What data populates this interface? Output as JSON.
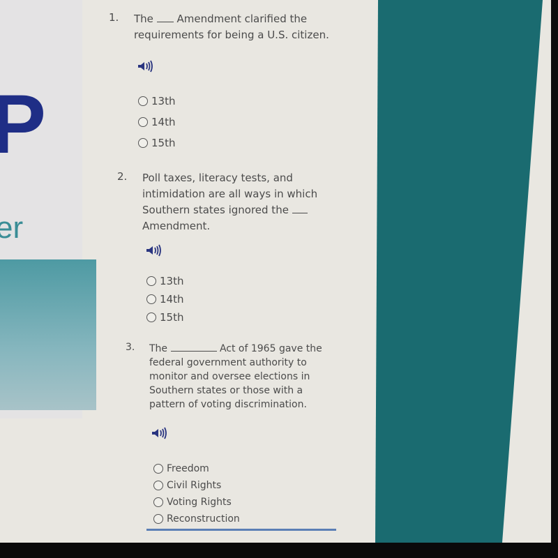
{
  "banner": {
    "logo_letter": "P",
    "logo_subtext": "er"
  },
  "questions": [
    {
      "number": "1.",
      "text_before": "The",
      "text_after": "Amendment clarified the requirements for being a U.S. citizen.",
      "audio_icon": "speaker-icon",
      "options": [
        "13th",
        "14th",
        "15th"
      ]
    },
    {
      "number": "2.",
      "text_before": "Poll taxes, literacy tests, and intimidation are all ways in which Southern states ignored the",
      "text_after": "Amendment.",
      "audio_icon": "speaker-icon",
      "options": [
        "13th",
        "14th",
        "15th"
      ]
    },
    {
      "number": "3.",
      "text_before": "The",
      "text_after": "Act of 1965 gave the federal government authority to monitor and oversee elections in Southern states or those with a pattern of voting discrimination.",
      "audio_icon": "speaker-icon",
      "options": [
        "Freedom",
        "Civil Rights",
        "Voting Rights",
        "Reconstruction"
      ]
    }
  ],
  "colors": {
    "brand_blue": "#1f2e86",
    "brand_teal": "#3a8d96",
    "side_panel": "#1a6b70",
    "audio_icon": "#2a3580"
  }
}
